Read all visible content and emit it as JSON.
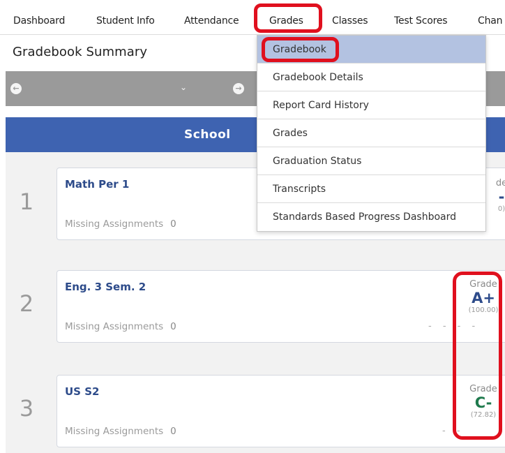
{
  "nav": {
    "items": [
      "Dashboard",
      "Student Info",
      "Attendance",
      "Grades",
      "Classes",
      "Test Scores",
      "Chan"
    ],
    "active": "Grades"
  },
  "page": {
    "title": "Gradebook Summary",
    "header": "School"
  },
  "grades_menu": {
    "items": [
      "Gradebook",
      "Gradebook Details",
      "Report Card History",
      "Grades",
      "Graduation Status",
      "Transcripts",
      "Standards Based Progress Dashboard"
    ],
    "selected": "Gradebook"
  },
  "courses": [
    {
      "period": "1",
      "name": "Math Per 1",
      "missing_label": "Missing Assignments",
      "missing_count": "0",
      "grade_label": "de",
      "grade_letter": "-",
      "grade_percent": "0)"
    },
    {
      "period": "2",
      "name": "Eng. 3 Sem. 2",
      "missing_label": "Missing Assignments",
      "missing_count": "0",
      "grade_label": "Grade",
      "grade_letter": "A+",
      "grade_percent": "(100.00)",
      "grade_color": "#2d4b8a"
    },
    {
      "period": "3",
      "name": "US S2",
      "missing_label": "Missing Assignments",
      "missing_count": "0",
      "grade_label": "Grade",
      "grade_letter": "C-",
      "grade_percent": "(72.82)",
      "grade_color": "#1f7a4d"
    }
  ],
  "colors": {
    "header_blue": "#3e63b1",
    "annotation_red": "#e0101e",
    "menu_selected": "#b3c2e1"
  }
}
